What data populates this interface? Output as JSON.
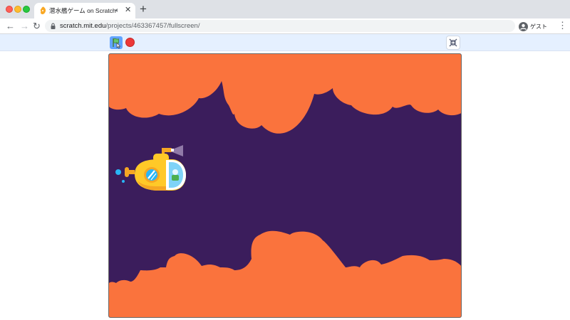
{
  "browser": {
    "tab": {
      "title": "潜水艦ゲーム on Scratch",
      "favicon": "scratch-favicon",
      "audio_icon": "speaker-icon",
      "close_icon": "close-icon"
    },
    "new_tab_icon": "plus-icon",
    "nav": {
      "back_icon": "arrow-left-icon",
      "forward_icon": "arrow-right-icon",
      "reload_icon": "reload-icon"
    },
    "address": {
      "host": "scratch.mit.edu",
      "path": "/projects/463367457/fullscreen/",
      "lock_icon": "lock-icon"
    },
    "profile": {
      "name": "ゲスト",
      "icon": "account-icon"
    },
    "menu_icon": "more-vert-icon"
  },
  "scratch": {
    "controls": {
      "green_flag_icon": "green-flag-icon",
      "stop_icon": "stop-icon",
      "unfullscreen_icon": "unfullscreen-icon"
    },
    "stage": {
      "background_color": "#3b1d5c",
      "cave_color": "#fa733d",
      "sprite": "submarine"
    }
  },
  "colors": {
    "titlebar": "#dee1e6",
    "scratch_blue": "#4c97ff",
    "stop_red": "#ec3838",
    "submarine_yellow": "#ffc928",
    "submarine_orange": "#f5a623"
  }
}
